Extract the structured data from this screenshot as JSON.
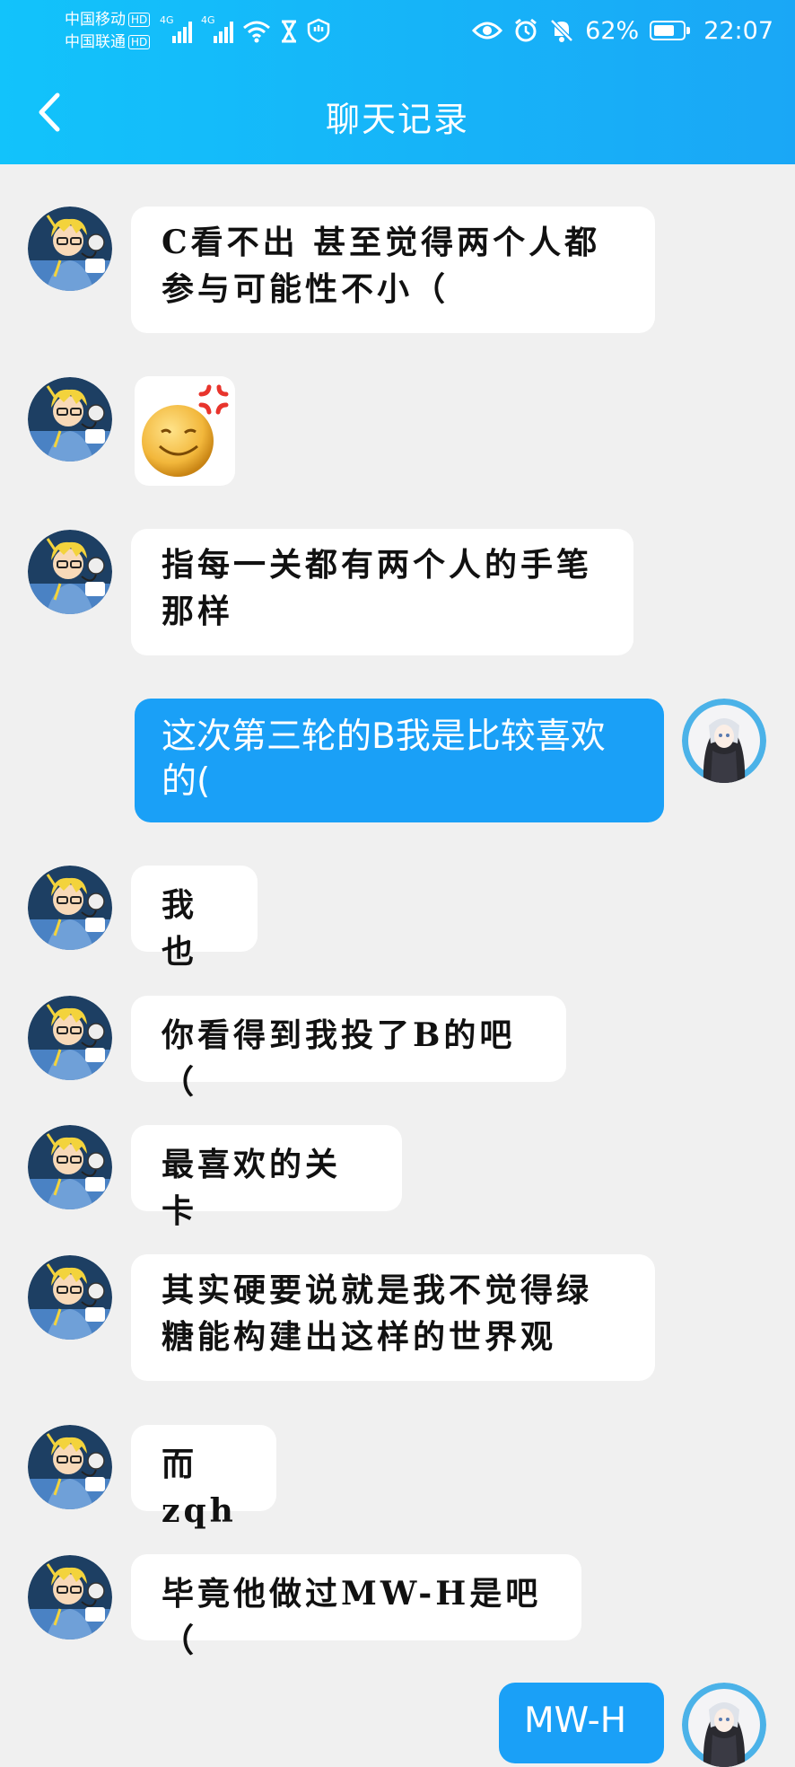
{
  "status_bar": {
    "carrier1": "中国移动",
    "carrier2": "中国联通",
    "hd_label": "HD",
    "net1": "4G",
    "net2": "4G",
    "battery": "62%",
    "time": "22:07"
  },
  "header": {
    "title": "聊天记录"
  },
  "messages": [
    {
      "text": "C看不出 甚至觉得两个人都参与可能性不小（"
    },
    {
      "sticker": "angry-smiley-sticker"
    },
    {
      "text": "指每一关都有两个人的手笔那样"
    },
    {
      "text": "这次第三轮的B我是比较喜欢的("
    },
    {
      "text": "我也"
    },
    {
      "text": "你看得到我投了B的吧（"
    },
    {
      "text": "最喜欢的关卡"
    },
    {
      "text": "其实硬要说就是我不觉得绿糖能构建出这样的世界观"
    },
    {
      "text": "而zqh"
    },
    {
      "text": "毕竟他做过MW-H是吧（"
    },
    {
      "text": "MW-H"
    }
  ],
  "colors": {
    "header": "#12c3fb",
    "own_bubble": "#1aa0f7",
    "background": "#f0f0f0"
  }
}
